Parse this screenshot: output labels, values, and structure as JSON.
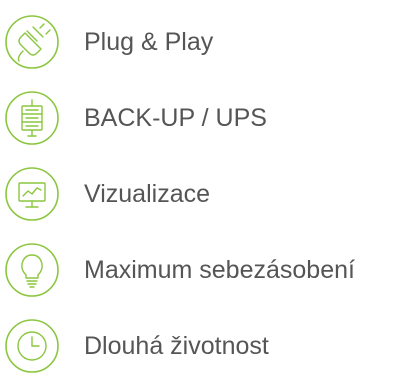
{
  "features": [
    {
      "icon": "plug-icon",
      "label": "Plug & Play"
    },
    {
      "icon": "server-icon",
      "label": "BACK-UP / UPS"
    },
    {
      "icon": "monitor-chart-icon",
      "label": "Vizualizace"
    },
    {
      "icon": "lightbulb-icon",
      "label": "Maximum sebezásobení"
    },
    {
      "icon": "clock-icon",
      "label": "Dlouhá životnost"
    }
  ],
  "colors": {
    "accent": "#8cc63f",
    "text": "#555555",
    "background": "#ffffff"
  }
}
